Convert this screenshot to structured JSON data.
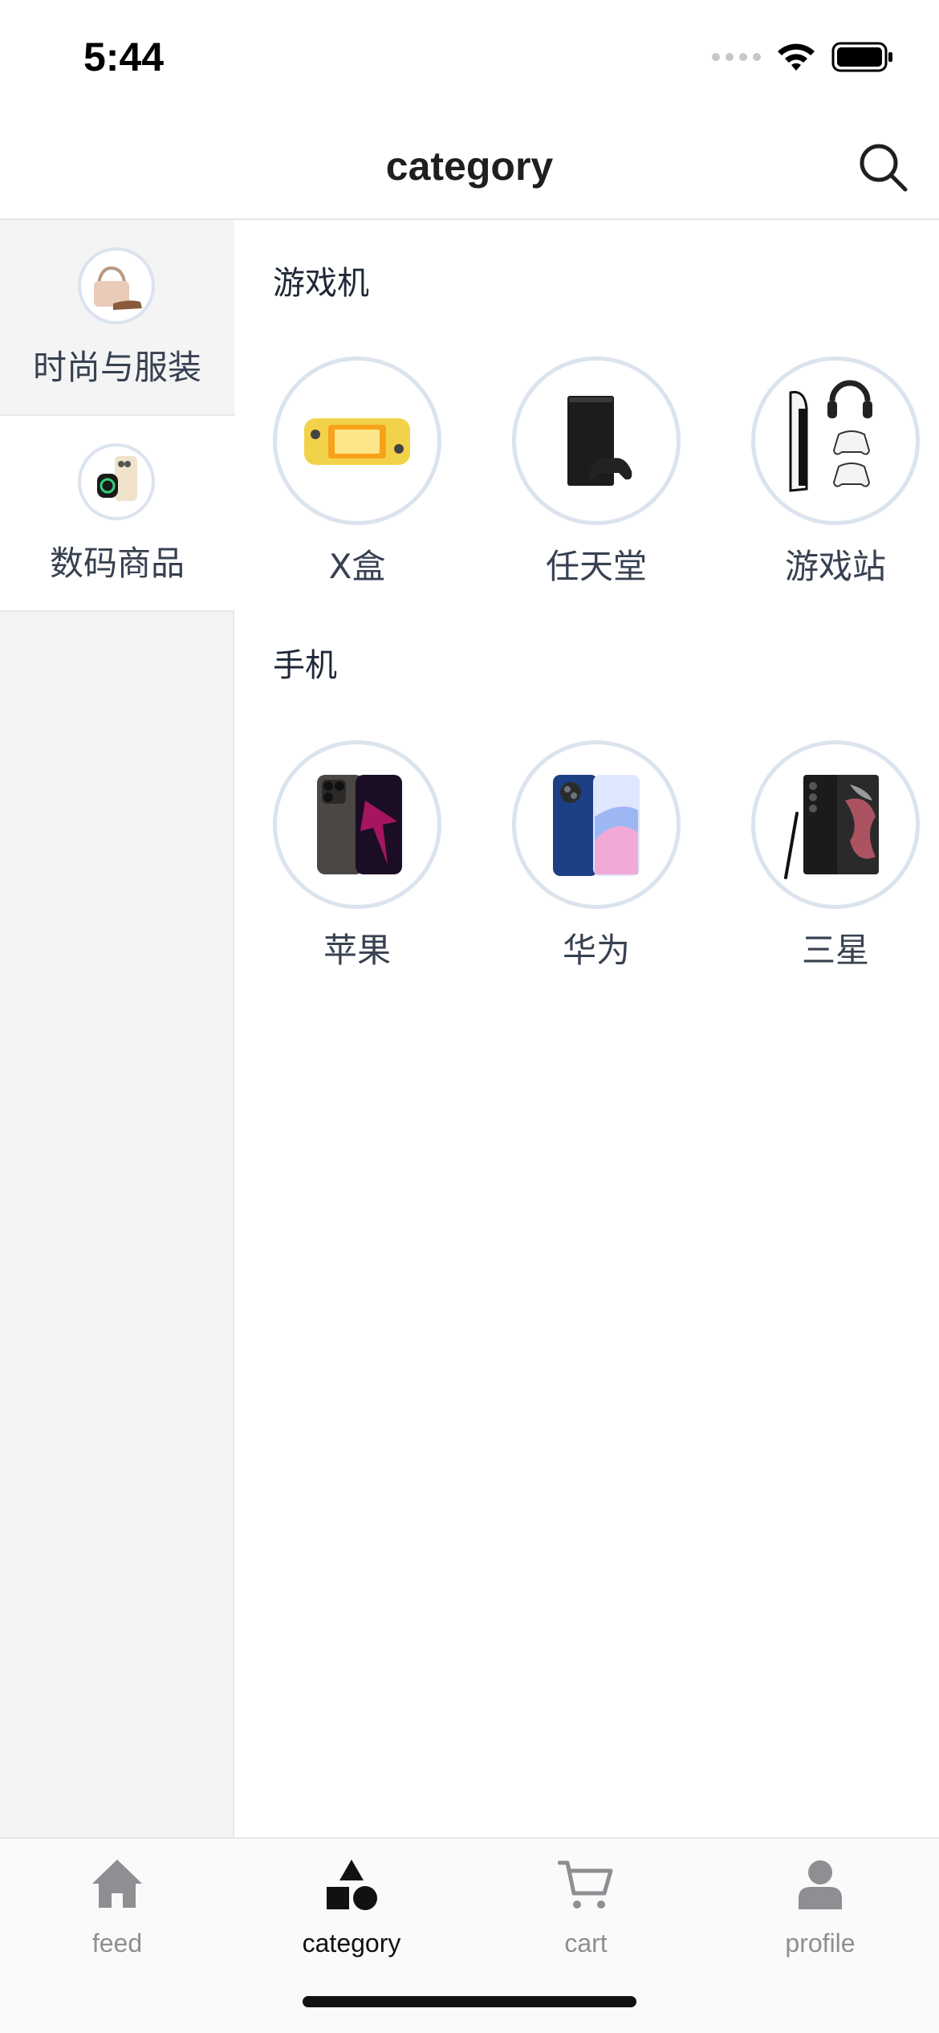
{
  "status_bar": {
    "time": "5:44"
  },
  "header": {
    "title": "category"
  },
  "sidebar": {
    "items": [
      {
        "label": "时尚与服装",
        "icon": "handbag-shoe-thumb",
        "active": true
      },
      {
        "label": "数码商品",
        "icon": "phone-watch-thumb",
        "active": false
      }
    ]
  },
  "sections": [
    {
      "title": "游戏机",
      "brands": [
        {
          "label": "X盒",
          "icon": "handheld-console-image"
        },
        {
          "label": "任天堂",
          "icon": "xbox-console-image"
        },
        {
          "label": "游戏站",
          "icon": "playstation-console-image"
        }
      ]
    },
    {
      "title": "手机",
      "brands": [
        {
          "label": "苹果",
          "icon": "iphone-image"
        },
        {
          "label": "华为",
          "icon": "huawei-phone-image"
        },
        {
          "label": "三星",
          "icon": "samsung-phone-image"
        }
      ]
    }
  ],
  "tab_bar": {
    "tabs": [
      {
        "label": "feed",
        "icon": "home-icon",
        "active": false
      },
      {
        "label": "category",
        "icon": "shapes-icon",
        "active": true
      },
      {
        "label": "cart",
        "icon": "cart-icon",
        "active": false
      },
      {
        "label": "profile",
        "icon": "person-icon",
        "active": false
      }
    ]
  },
  "colors": {
    "active_tab": "#111111",
    "inactive_tab": "#8e8e93",
    "circle_border": "#dbe3ee",
    "sidebar_bg": "#f4f4f5"
  }
}
